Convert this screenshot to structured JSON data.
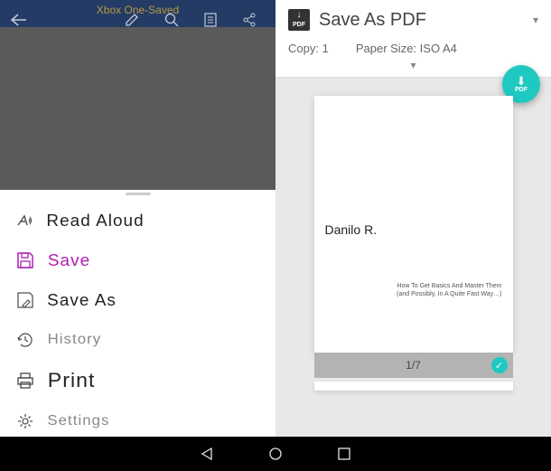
{
  "left": {
    "doc_title": "Xbox One-Saved",
    "menu": {
      "read_aloud": "Read Aloud",
      "save": "Save",
      "save_as": "Save As",
      "history": "History",
      "print": "Print",
      "settings": "Settings"
    }
  },
  "right": {
    "header_title": "Save As PDF",
    "copy_label": "Copy:",
    "copy_value": "1",
    "paper_label": "Paper Size:",
    "paper_value": "ISO A4",
    "page_author": "Danilo R.",
    "page_sub_line1": "How To Get Basics And Master Them",
    "page_sub_line2": "(and Possibly, In A Quite Fast Way…)",
    "page_indicator": "1/7",
    "fab_label": "PDF"
  }
}
